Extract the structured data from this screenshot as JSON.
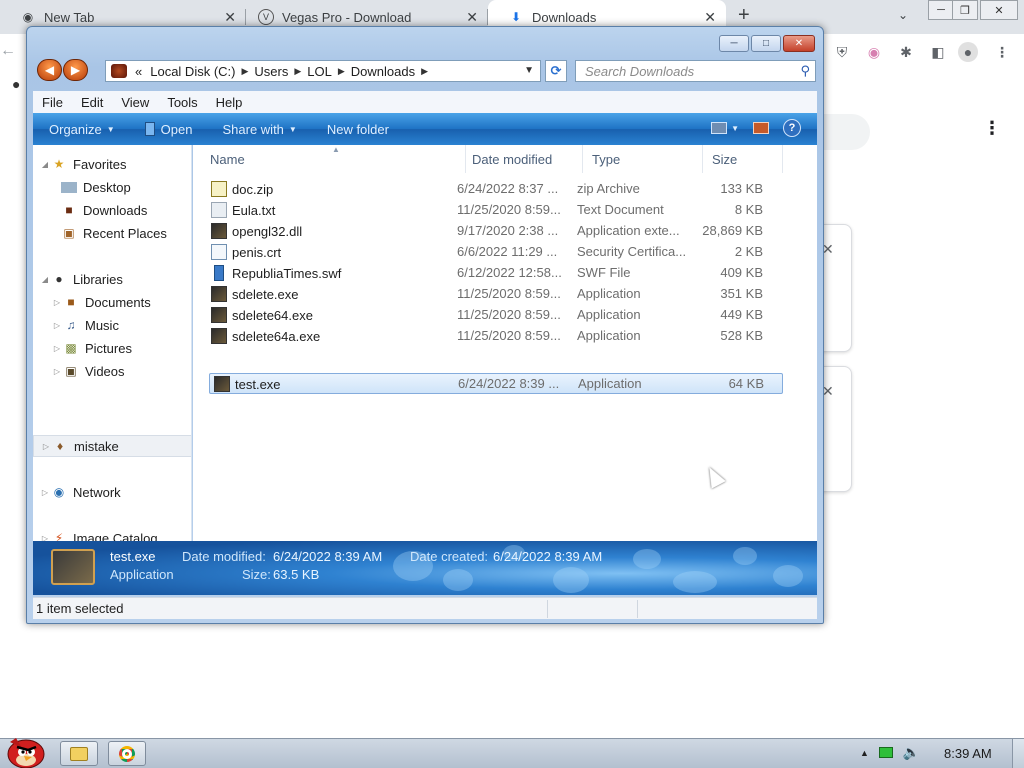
{
  "browser": {
    "tabs": [
      {
        "label": "New Tab",
        "icon": "chrome-icon"
      },
      {
        "label": "Vegas Pro - Download",
        "icon": "vegas-icon"
      },
      {
        "label": "Downloads",
        "icon": "download-icon"
      }
    ],
    "new_tab_label": "+"
  },
  "explorer": {
    "address": {
      "overflow": "«",
      "crumbs": [
        "Local Disk (C:)",
        "Users",
        "LOL",
        "Downloads"
      ]
    },
    "search_placeholder": "Search Downloads",
    "menu": [
      "File",
      "Edit",
      "View",
      "Tools",
      "Help"
    ],
    "commands": {
      "organize": "Organize",
      "open": "Open",
      "share_with": "Share with",
      "new_folder": "New folder"
    },
    "nav": {
      "favorites": "Favorites",
      "desktop": "Desktop",
      "downloads": "Downloads",
      "recent_places": "Recent Places",
      "libraries": "Libraries",
      "documents": "Documents",
      "music": "Music",
      "pictures": "Pictures",
      "videos": "Videos",
      "mistake": "mistake",
      "network": "Network",
      "image_catalog": "Image Catalog"
    },
    "columns": {
      "name": "Name",
      "date": "Date modified",
      "type": "Type",
      "size": "Size"
    },
    "files": [
      {
        "name": "doc.zip",
        "date": "6/24/2022 8:37 ...",
        "type": "zip Archive",
        "size": "133 KB",
        "icon": "zip-file-icon"
      },
      {
        "name": "Eula.txt",
        "date": "11/25/2020 8:59...",
        "type": "Text Document",
        "size": "8 KB",
        "icon": "text-file-icon"
      },
      {
        "name": "opengl32.dll",
        "date": "9/17/2020 2:38 ...",
        "type": "Application exte...",
        "size": "28,869 KB",
        "icon": "dll-file-icon"
      },
      {
        "name": "penis.crt",
        "date": "6/6/2022 11:29 ...",
        "type": "Security Certifica...",
        "size": "2 KB",
        "icon": "certificate-file-icon"
      },
      {
        "name": "RepubliaTimes.swf",
        "date": "6/12/2022 12:58...",
        "type": "SWF File",
        "size": "409 KB",
        "icon": "swf-file-icon"
      },
      {
        "name": "sdelete.exe",
        "date": "11/25/2020 8:59...",
        "type": "Application",
        "size": "351 KB",
        "icon": "exe-file-icon"
      },
      {
        "name": "sdelete64.exe",
        "date": "11/25/2020 8:59...",
        "type": "Application",
        "size": "449 KB",
        "icon": "exe-file-icon"
      },
      {
        "name": "sdelete64a.exe",
        "date": "11/25/2020 8:59...",
        "type": "Application",
        "size": "528 KB",
        "icon": "exe-file-icon"
      },
      {
        "name": "test.exe",
        "date": "6/24/2022 8:39 ...",
        "type": "Application",
        "size": "64 KB",
        "icon": "exe-file-icon",
        "selected": true
      }
    ],
    "details": {
      "name": "test.exe",
      "type": "Application",
      "date_modified_label": "Date modified:",
      "date_modified": "6/24/2022 8:39 AM",
      "date_created_label": "Date created:",
      "date_created": "6/24/2022 8:39 AM",
      "size_label": "Size:",
      "size": "63.5 KB"
    },
    "status": "1 item selected"
  },
  "taskbar": {
    "clock": "8:39 AM"
  },
  "colors": {
    "command_bar": "#1e72c4",
    "selection": "#cfe4f9",
    "nav_arrows": "#e0601c"
  }
}
